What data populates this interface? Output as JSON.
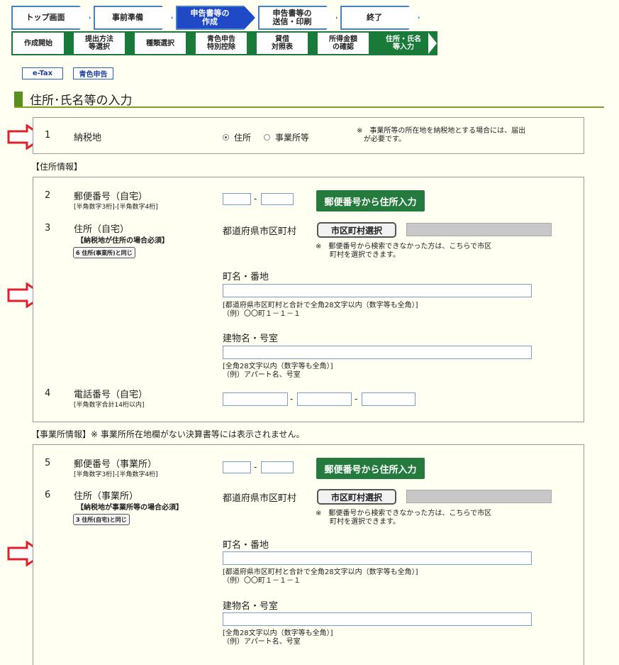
{
  "nav_main": [
    {
      "label": "トップ画面",
      "active": false
    },
    {
      "label": "事前準備",
      "active": false
    },
    {
      "label": "申告書等の\n作成",
      "active": true
    },
    {
      "label": "申告書等の\n送信・印刷",
      "active": false
    },
    {
      "label": "終了",
      "active": false
    }
  ],
  "nav_sub": [
    {
      "label": "作成開始",
      "active": false
    },
    {
      "label": "提出方法\n等選択",
      "active": false
    },
    {
      "label": "種類選択",
      "active": false
    },
    {
      "label": "青色申告\n特別控除",
      "active": false
    },
    {
      "label": "貸借\n対照表",
      "active": false
    },
    {
      "label": "所得金額\nの確認",
      "active": false
    },
    {
      "label": "住所・氏名\n等入力",
      "active": true
    }
  ],
  "chips": {
    "etax": "e-Tax",
    "blue": "青色申告"
  },
  "page_title": "住所･氏名等の入力",
  "section1": {
    "num": "1",
    "label": "納税地",
    "radio_home": "住所",
    "radio_office": "事業所等",
    "note": "※　事業所等の所在地を納税地とする場合には、届出\n　が必要です。"
  },
  "home_heading": "【住所情報】",
  "home": {
    "postal_num": "2",
    "postal_label": "郵便番号（自宅）",
    "postal_sub": "[半角数字3桁]-[半角数字4桁]",
    "dash": "-",
    "postal_btn": "郵便番号から住所入力",
    "addr_num": "3",
    "addr_label": "住所（自宅）",
    "addr_req": "【納税地が住所の場合必須】",
    "addr_same_btn": "6 住所(事業所)と同じ",
    "pref_label": "都道府県市区町村",
    "city_btn": "市区町村選択",
    "city_note": "※　郵便番号から検索できなかった方は、こちらで市区\n　　町村を選択できます。",
    "town_label": "町名・番地",
    "town_note": "[都道府県市区町村と合計で全角28文字以内（数字等も全角）]\n（例）〇〇町１－１－１",
    "bldg_label": "建物名・号室",
    "bldg_note": "[全角28文字以内（数字等も全角）]\n（例）アパート名、号室",
    "tel_num": "4",
    "tel_label": "電話番号（自宅）",
    "tel_sub": "[半角数字合計14桁以内]"
  },
  "office_heading": "【事業所情報】※ 事業所所在地欄がない決算書等には表示されません。",
  "office": {
    "postal_num": "5",
    "postal_label": "郵便番号（事業所）",
    "postal_sub": "[半角数字3桁]-[半角数字4桁]",
    "dash": "-",
    "postal_btn": "郵便番号から住所入力",
    "addr_num": "6",
    "addr_label": "住所（事業所）",
    "addr_req": "【納税地が事業所等の場合必須】",
    "addr_same_btn": "3 住所(自宅)と同じ",
    "pref_label": "都道府県市区町村",
    "city_btn": "市区町村選択",
    "city_note": "※　郵便番号から検索できなかった方は、こちらで市区\n　　町村を選択できます。",
    "town_label": "町名・番地",
    "town_note": "[都道府県市区町村と合計で全角28文字以内（数字等も全角）]\n（例）〇〇町１－１－１",
    "bldg_label": "建物名・号室",
    "bldg_note": "[全角28文字以内（数字等も全角）]\n（例）アパート名、号室"
  }
}
